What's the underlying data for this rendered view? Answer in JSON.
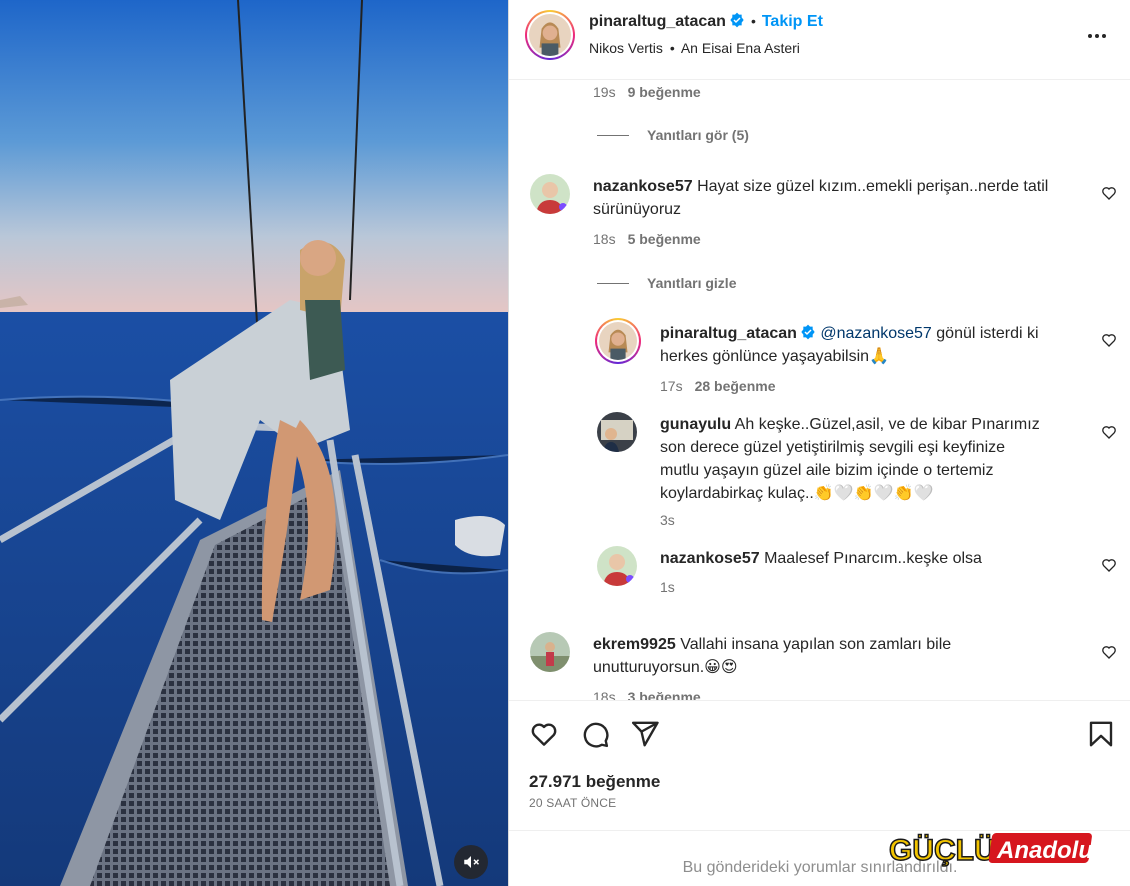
{
  "post": {
    "author": "pinaraltug_atacan",
    "follow_label": "Takip Et",
    "dot": "•",
    "subtitle_artist": "Nikos Vertis",
    "subtitle_song": "An Eisai Ena Asteri"
  },
  "comments": [
    {
      "type": "meta",
      "time": "19s",
      "likes": "9 beğenme"
    },
    {
      "type": "toggle",
      "label": "Yanıtları gör (5)"
    },
    {
      "type": "comment",
      "user": "nazankose57",
      "text": "Hayat size güzel kızım..emekli perişan..nerde tatil",
      "text2": "sürünüyoruz",
      "time": "18s",
      "likes": "5 beğenme"
    },
    {
      "type": "toggle",
      "label": "Yanıtları gizle"
    },
    {
      "type": "reply",
      "user": "pinaraltug_atacan",
      "mention": "@nazankose57",
      "text": " gönül isterdi ki",
      "text2": "herkes gönlünce yaşayabilsin🙏",
      "time": "17s",
      "likes": "28 beğenme"
    },
    {
      "type": "reply",
      "user": "gunayulu",
      "text": "Ah keşke..Güzel,asil, ve de kibar Pınarımız",
      "text2": "son derece güzel yetiştirilmiş sevgili eşi keyfinize",
      "text3": "mutlu yaşayın güzel aile bizim içinde o tertemiz",
      "text4": "koylardabirkaç kulaç..👏🤍👏🤍👏🤍",
      "time": "3s"
    },
    {
      "type": "reply",
      "user": "nazankose57",
      "text": "Maalesef Pınarcım..keşke olsa",
      "time": "1s"
    },
    {
      "type": "comment",
      "user": "ekrem9925",
      "text": "Vallahi insana yapılan son zamları bile",
      "text2": "unutturuyorsun.😀😍",
      "time": "18s",
      "likes": "3 beğenme"
    }
  ],
  "actions": {
    "likes_count": "27.971 beğenme",
    "time_ago": "20 SAAT ÖNCE"
  },
  "footer": {
    "limited_text": "Bu gönderideki yorumlar sınırlandırıldı."
  },
  "watermark": {
    "part1": "GÜÇLÜ",
    "part2": "Anadolu"
  },
  "colors": {
    "accent": "#0095f6",
    "mention": "#00376b",
    "muted": "#737373"
  },
  "icons": [
    "verified-badge-icon",
    "more-options-icon",
    "heart-icon",
    "comment-icon",
    "share-icon",
    "bookmark-icon",
    "mute-icon"
  ]
}
